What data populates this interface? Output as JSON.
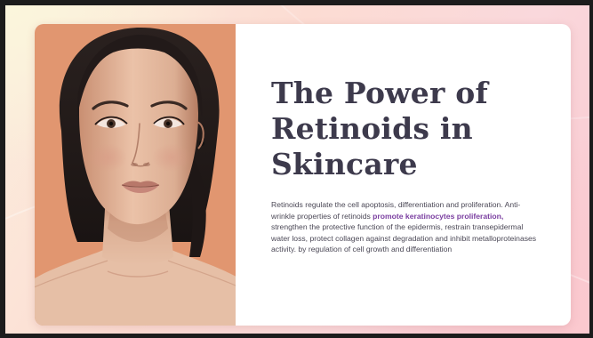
{
  "slide": {
    "title_lines": [
      "The Power of",
      "Retinoids in",
      "Skincare"
    ],
    "body": {
      "before": "Retinoids regulate the cell apoptosis, differentiation and proliferation. Anti-wrinkle properties of retinoids ",
      "highlight": "promote keratinocytes proliferation,",
      "after": " strengthen the protective function of the epidermis, restrain transepidermal water loss, protect collagen against degradation and inhibit metalloproteinases activity. by regulation of cell growth and differentiation"
    },
    "image": {
      "subject": "woman-portrait-photo",
      "background_color": "#e59b76"
    }
  },
  "colors": {
    "title": "#3d3a4c",
    "body_text": "#4b4856",
    "highlight": "#7a3ea0",
    "card": "#ffffff",
    "background_warm": "#fcdcd3",
    "background_pink": "#f9c7cf",
    "frame_border": "#1c1c1c"
  }
}
